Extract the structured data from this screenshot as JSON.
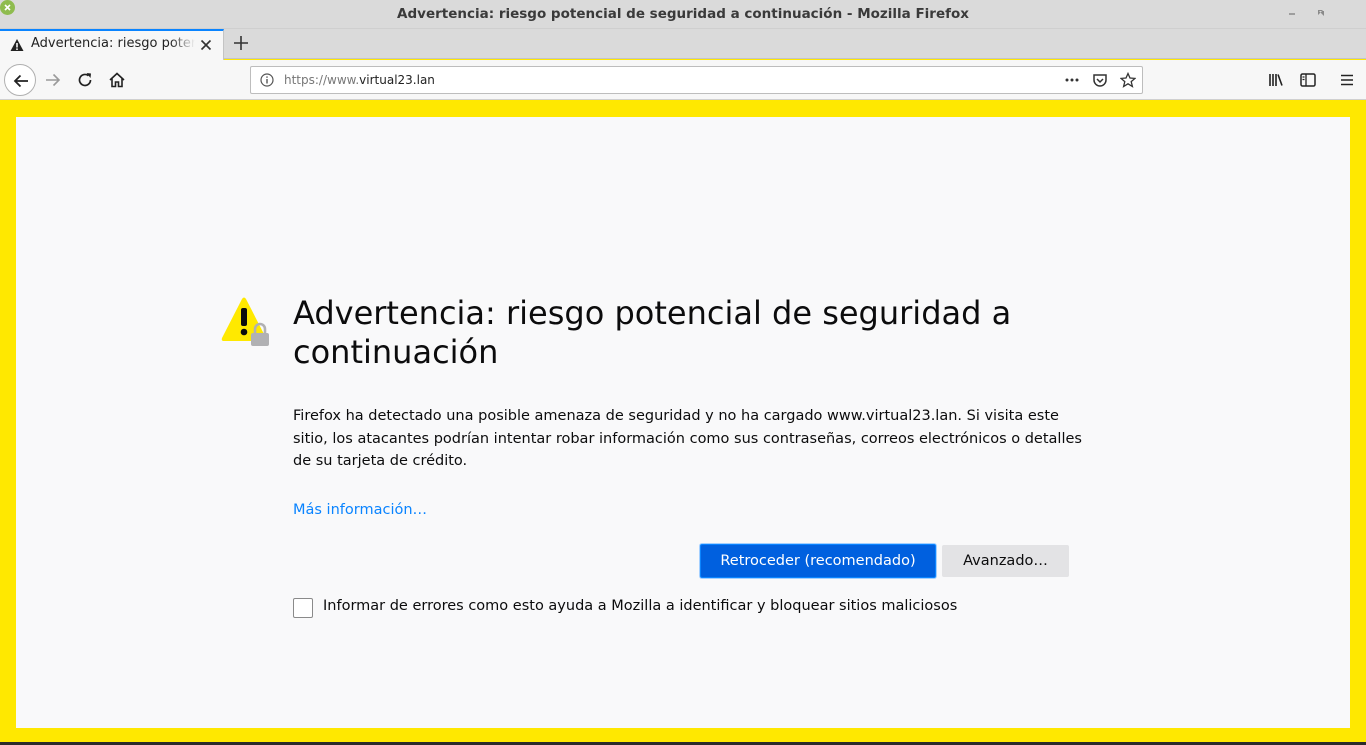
{
  "window": {
    "title": "Advertencia: riesgo potencial de seguridad a continuación - Mozilla Firefox"
  },
  "tabs": [
    {
      "label": "Advertencia: riesgo potencial de seguridad a continuación",
      "icon": "warning-icon",
      "active": true
    }
  ],
  "navbar": {
    "url_prefix": "https://www.",
    "url_host": "virtual23.lan",
    "icons": [
      "back-icon",
      "forward-icon",
      "reload-icon",
      "home-icon",
      "info-icon",
      "page-actions-icon",
      "pocket-icon",
      "bookmark-star-icon",
      "library-icon",
      "sidebar-icon",
      "menu-icon"
    ]
  },
  "page": {
    "heading": "Advertencia: riesgo potencial de seguridad a continuación",
    "description": "Firefox ha detectado una posible amenaza de seguridad y no ha cargado www.virtual23.lan. Si visita este sitio, los atacantes podrían intentar robar información como sus contraseñas, correos electrónicos o detalles de su tarjeta de crédito.",
    "more_info_link": "Más información…",
    "primary_button": "Retroceder (recomendado)",
    "secondary_button": "Avanzado…",
    "report_checkbox_label": "Informar de errores como esto ayuda a Mozilla a identificar y bloquear sitios maliciosos",
    "report_checked": false
  },
  "colors": {
    "frame_highlight": "#ffe800",
    "primary_button": "#0060df",
    "link": "#0a84ff",
    "content_bg": "#f9f9fa",
    "warning_icon": "#ffe900"
  }
}
